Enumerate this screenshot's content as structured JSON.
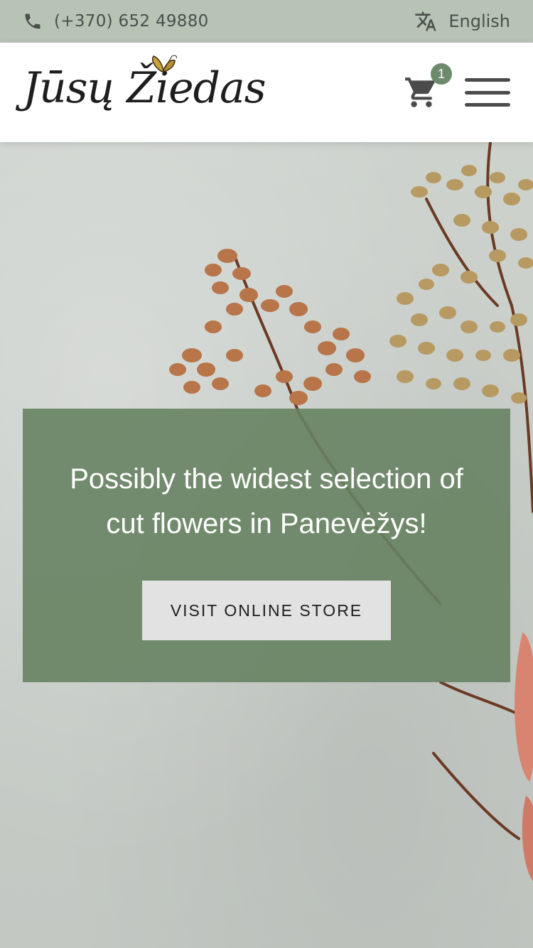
{
  "topbar": {
    "phone_icon": "phone-icon",
    "phone": "(+370) 652 49880",
    "language_icon": "translate-icon",
    "language": "English"
  },
  "header": {
    "logo_text": "Jūsų Žiedas",
    "cart_icon": "shopping-cart-icon",
    "cart_count": "1",
    "menu_icon": "hamburger-menu-icon"
  },
  "hero": {
    "headline": "Possibly the widest selection of cut flowers in Panevėžys!",
    "cta_label": "VISIT ONLINE STORE"
  },
  "colors": {
    "topbar_bg": "#b7c4b5",
    "accent_green": "#6c8a6c",
    "promo_bg": "#678262",
    "button_bg": "#e2e2e2"
  }
}
